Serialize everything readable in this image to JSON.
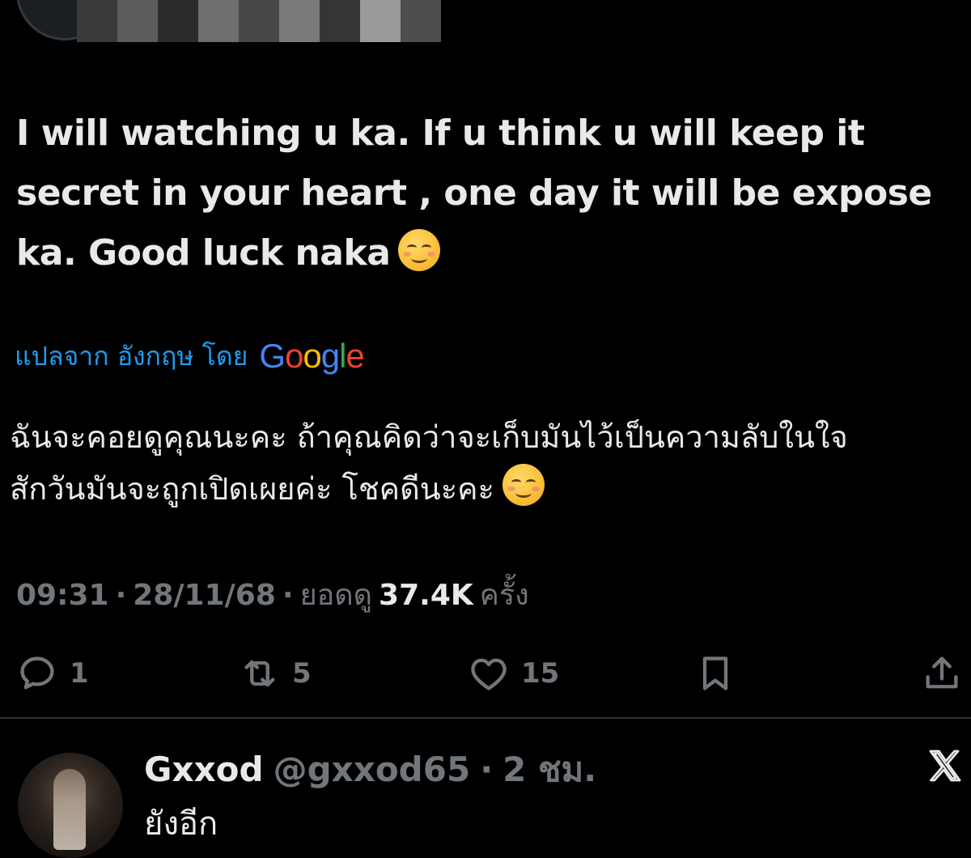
{
  "colors": {
    "background": "#000000",
    "text_primary": "#e7e9ea",
    "text_secondary": "#71767b",
    "link_blue": "#1d9bf0",
    "divider": "#2f3336"
  },
  "tweet": {
    "lines": [
      "I will watching u ka. If u think u will keep it",
      "secret in your heart , one day it will be expose",
      "ka. Good luck naka"
    ],
    "emoji_name": "smiling-face-icon"
  },
  "translation": {
    "label": "แปลจาก อังกฤษ โดย",
    "provider": {
      "letters": [
        "G",
        "o",
        "o",
        "g",
        "l",
        "e"
      ]
    },
    "lines": [
      "ฉันจะคอยดูคุณนะคะ ถ้าคุณคิดว่าจะเก็บมันไว้เป็นความลับในใจ",
      "สักวันมันจะถูกเปิดเผยค่ะ โชคดีนะคะ"
    ]
  },
  "meta": {
    "time": "09:31",
    "separator": "·",
    "date": "28/11/68",
    "views_label": "ยอดดู",
    "views_count": "37.4K",
    "views_unit": "ครั้ง"
  },
  "actions": {
    "reply_count": "1",
    "retweet_count": "5",
    "like_count": "15"
  },
  "reply": {
    "display_name": "Gxxod",
    "handle": "@gxxod65",
    "separator": "·",
    "time": "2 ชม.",
    "text": "ยังอีก"
  }
}
